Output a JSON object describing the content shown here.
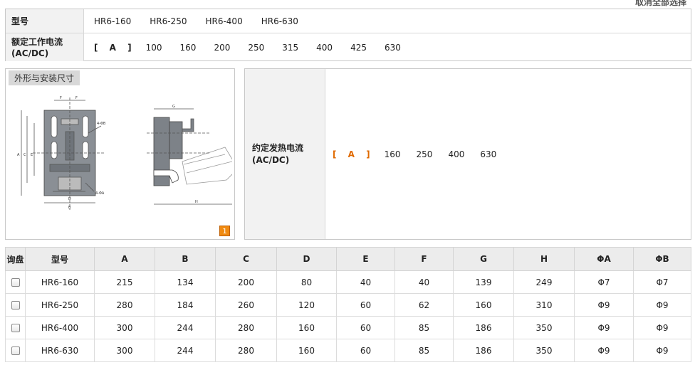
{
  "top_link": "取消全部选择",
  "filter": {
    "model_label": "型号",
    "models": [
      "HR6-160",
      "HR6-250",
      "HR6-400",
      "HR6-630"
    ],
    "current_label_1": "额定工作电流",
    "current_label_2": "(AC/DC)",
    "unit": "[ A ]",
    "currents": [
      "100",
      "160",
      "200",
      "250",
      "315",
      "400",
      "425",
      "630"
    ]
  },
  "drawing": {
    "title": "外形与安装尺寸",
    "page_num": "1"
  },
  "heat": {
    "label_1": "约定发热电流",
    "label_2": "(AC/DC)",
    "unit": "[ A ]",
    "values": [
      "160",
      "250",
      "400",
      "630"
    ]
  },
  "table": {
    "headers": [
      "询盘",
      "型号",
      "A",
      "B",
      "C",
      "D",
      "E",
      "F",
      "G",
      "H",
      "ΦA",
      "ΦB"
    ],
    "rows": [
      [
        "HR6-160",
        "215",
        "134",
        "200",
        "80",
        "40",
        "40",
        "139",
        "249",
        "Φ7",
        "Φ7"
      ],
      [
        "HR6-250",
        "280",
        "184",
        "260",
        "120",
        "60",
        "62",
        "160",
        "310",
        "Φ9",
        "Φ9"
      ],
      [
        "HR6-400",
        "300",
        "244",
        "280",
        "160",
        "60",
        "85",
        "186",
        "350",
        "Φ9",
        "Φ9"
      ],
      [
        "HR6-630",
        "300",
        "244",
        "280",
        "160",
        "60",
        "85",
        "186",
        "350",
        "Φ9",
        "Φ9"
      ]
    ]
  }
}
